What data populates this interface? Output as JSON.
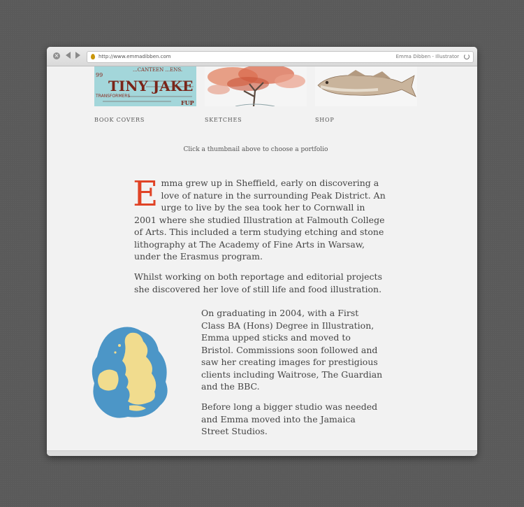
{
  "browser": {
    "url": "http://www.emmadibben.com",
    "title": "Emma Dibben - Illustrator"
  },
  "portfolio": {
    "items": [
      {
        "label": "BOOK COVERS",
        "thumb_text": {
          "top": "...CANTEEN ...ENS.",
          "mid": "TINY JAKE",
          "bottom": "TRANSFORMERS",
          "end": "FUP"
        }
      },
      {
        "label": "SKETCHES"
      },
      {
        "label": "SHOP"
      }
    ],
    "hint": "Click a thumbnail above to choose a portfolio"
  },
  "bio": {
    "dropcap": "E",
    "p1_rest": "mma grew up in Sheffield, early on discovering a love of nature in the surrounding Peak District. An urge to live by the sea took her to Cornwall in 2001 where she studied Illustration at Falmouth College of Arts. This included a term studying etching and stone lithography at The Academy of Fine Arts in Warsaw, under the Erasmus program.",
    "p2": "Whilst working on both reportage and editorial projects she discovered her love of still life and food illustration.",
    "p3": "On graduating in 2004, with a First Class BA (Hons) Degree in Illustration, Emma upped sticks and moved to Bristol. Commissions soon followed and saw her creating images for prestigious clients including Waitrose, The Guardian and the BBC.",
    "p4": "Before long a bigger studio was needed and Emma moved into the Jamaica Street Studios."
  },
  "colors": {
    "accent": "#e04326",
    "text": "#444444",
    "page_bg": "#f2f2f2"
  }
}
